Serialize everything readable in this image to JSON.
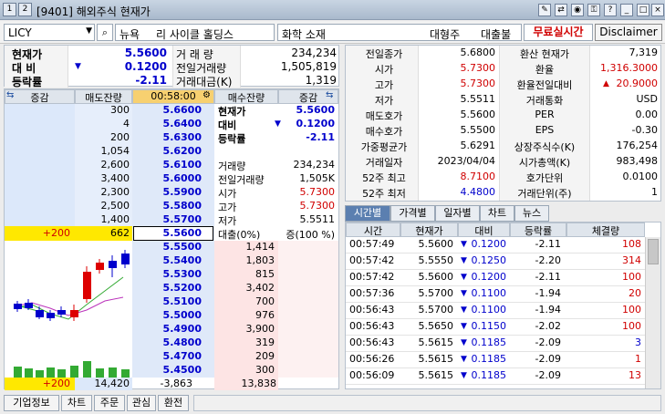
{
  "window": {
    "title": "[9401] 해외주식 현재가"
  },
  "toolbar": {
    "symbol": "LICY",
    "exchange": "뉴욕",
    "company": "리 사이클 홀딩스",
    "sector": "화학 소재",
    "size": "대형주",
    "loan": "대출불가",
    "free_realtime": "무료실시간",
    "disclaimer": "Disclaimer"
  },
  "summary": {
    "rows": [
      {
        "l1": "현재가",
        "v1": "5.5600",
        "l2": "거 래 량",
        "v2": "234,234"
      },
      {
        "l1": "대 비",
        "v1": "0.1200",
        "l2": "전일거래량",
        "v2": "1,505,819"
      },
      {
        "l1": "등락률",
        "v1": "-2.11",
        "l2": "거래대금(K)",
        "v2": "1,319"
      }
    ]
  },
  "info": {
    "rows": [
      {
        "k": "전일종가",
        "v": "5.6800",
        "k2": "환산 현재가",
        "v2": "7,319"
      },
      {
        "k": "시가",
        "v": "5.7300",
        "k2": "환율",
        "v2": "1,316.3000"
      },
      {
        "k": "고가",
        "v": "5.7300",
        "k2": "환율전일대비",
        "v2": "20.9000"
      },
      {
        "k": "저가",
        "v": "5.5511",
        "k2": "거래통화",
        "v2": "USD"
      },
      {
        "k": "매도호가",
        "v": "5.5600",
        "k2": "PER",
        "v2": "0.00"
      },
      {
        "k": "매수호가",
        "v": "5.5500",
        "k2": "EPS",
        "v2": "-0.30"
      },
      {
        "k": "가중평균가",
        "v": "5.6291",
        "k2": "상장주식수(K)",
        "v2": "176,254"
      },
      {
        "k": "거래일자",
        "v": "2023/04/04",
        "k2": "시가총액(K)",
        "v2": "983,498"
      },
      {
        "k": "52주 최고",
        "v": "8.7100",
        "k2": "호가단위",
        "v2": "0.0100"
      },
      {
        "k": "52주 최저",
        "v": "4.4800",
        "k2": "거래단위(주)",
        "v2": "1"
      }
    ]
  },
  "orderbook": {
    "headers": {
      "inc": "증감",
      "ask_qty": "매도잔량",
      "time": "00:58:00",
      "bid_qty": "매수잔량",
      "inc2": "증감"
    },
    "asks": [
      {
        "qty": "300",
        "price": "5.6600"
      },
      {
        "qty": "4",
        "price": "5.6400"
      },
      {
        "qty": "200",
        "price": "5.6300"
      },
      {
        "qty": "1,054",
        "price": "5.6200"
      },
      {
        "qty": "2,600",
        "price": "5.6100"
      },
      {
        "qty": "3,400",
        "price": "5.6000"
      },
      {
        "qty": "2,300",
        "price": "5.5900"
      },
      {
        "qty": "2,500",
        "price": "5.5800"
      },
      {
        "qty": "1,400",
        "price": "5.5700"
      },
      {
        "qty": "662",
        "price": "5.5600",
        "inc": "+200"
      }
    ],
    "ask_info_top": [
      {
        "k": "현재가",
        "v": "5.5600"
      },
      {
        "k": "대비",
        "v": "0.1200"
      },
      {
        "k": "등락률",
        "v": "-2.11"
      }
    ],
    "ask_info_bottom": [
      {
        "k": "거래량",
        "v": "234,234"
      },
      {
        "k": "전일거래량",
        "v": "1,505K"
      },
      {
        "k": "시가",
        "v": "5.7300"
      },
      {
        "k": "고가",
        "v": "5.7300"
      },
      {
        "k": "저가",
        "v": "5.5511"
      },
      {
        "k": "대출(0%)",
        "v": "증(100 %)"
      }
    ],
    "bids": [
      {
        "price": "5.5500",
        "qty": "1,414"
      },
      {
        "price": "5.5400",
        "qty": "1,803"
      },
      {
        "price": "5.5300",
        "qty": "815"
      },
      {
        "price": "5.5200",
        "qty": "3,402"
      },
      {
        "price": "5.5100",
        "qty": "700"
      },
      {
        "price": "5.5000",
        "qty": "976"
      },
      {
        "price": "5.4900",
        "qty": "3,900"
      },
      {
        "price": "5.4800",
        "qty": "319"
      },
      {
        "price": "5.4700",
        "qty": "209"
      },
      {
        "price": "5.4500",
        "qty": "300"
      }
    ],
    "totals": {
      "inc": "+200",
      "ask_total": "14,420",
      "diff": "-3,863",
      "bid_total": "13,838"
    }
  },
  "tabs": [
    "시간별",
    "가격별",
    "일자별",
    "차트",
    "뉴스"
  ],
  "trades": {
    "headers": [
      "시간",
      "현재가",
      "대비",
      "등락률",
      "체결량"
    ],
    "rows": [
      {
        "t": "00:57:49",
        "p": "5.5600",
        "d": "0.1200",
        "r": "-2.11",
        "q": "108",
        "qc": "red"
      },
      {
        "t": "00:57:42",
        "p": "5.5550",
        "d": "0.1250",
        "r": "-2.20",
        "q": "314",
        "qc": "red"
      },
      {
        "t": "00:57:42",
        "p": "5.5600",
        "d": "0.1200",
        "r": "-2.11",
        "q": "100",
        "qc": "red"
      },
      {
        "t": "00:57:36",
        "p": "5.5700",
        "d": "0.1100",
        "r": "-1.94",
        "q": "20",
        "qc": "red"
      },
      {
        "t": "00:56:43",
        "p": "5.5700",
        "d": "0.1100",
        "r": "-1.94",
        "q": "100",
        "qc": "red"
      },
      {
        "t": "00:56:43",
        "p": "5.5650",
        "d": "0.1150",
        "r": "-2.02",
        "q": "100",
        "qc": "red"
      },
      {
        "t": "00:56:43",
        "p": "5.5615",
        "d": "0.1185",
        "r": "-2.09",
        "q": "3",
        "qc": "blue"
      },
      {
        "t": "00:56:26",
        "p": "5.5615",
        "d": "0.1185",
        "r": "-2.09",
        "q": "1",
        "qc": "red"
      },
      {
        "t": "00:56:09",
        "p": "5.5615",
        "d": "0.1185",
        "r": "-2.09",
        "q": "13",
        "qc": "red"
      }
    ]
  },
  "bottom": [
    "기업정보",
    "차트",
    "주문",
    "관심",
    "환전"
  ]
}
